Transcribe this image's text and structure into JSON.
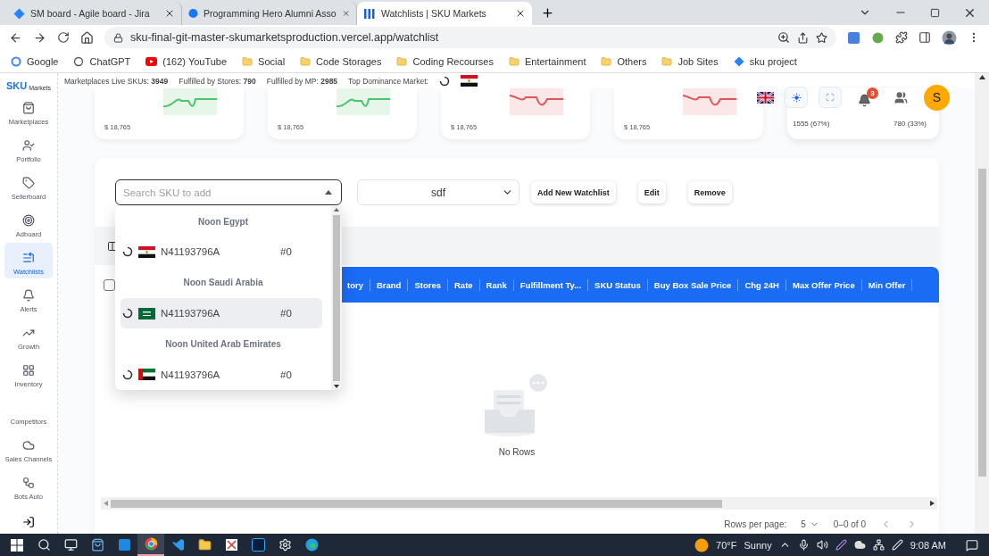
{
  "browser": {
    "tabs": [
      {
        "title": "SM board - Agile board - Jira",
        "selected": false
      },
      {
        "title": "Programming Hero Alumni Asso",
        "selected": false
      },
      {
        "title": "Watchlists | SKU Markets",
        "selected": true
      }
    ],
    "url": "sku-final-git-master-skumarketsproduction.vercel.app/watchlist",
    "bookmarks": [
      "Google",
      "ChatGPT",
      "(162) YouTube",
      "Social",
      "Code Storages",
      "Coding Recourses",
      "Entertainment",
      "Others",
      "Job Sites",
      "sku project"
    ]
  },
  "logo": {
    "brand": "SKU",
    "suffix": "Markets"
  },
  "sidebar": {
    "items": [
      {
        "label": "Marketplaces",
        "selected": false
      },
      {
        "label": "Portfolio",
        "selected": false
      },
      {
        "label": "Sellerboard",
        "selected": false
      },
      {
        "label": "Adboard",
        "selected": false
      },
      {
        "label": "Watchlists",
        "selected": true
      },
      {
        "label": "Alerts",
        "selected": false
      },
      {
        "label": "Growth",
        "selected": false
      },
      {
        "label": "Inventory",
        "selected": false
      },
      {
        "label": "Competitors",
        "selected": false
      },
      {
        "label": "Sales Channels",
        "selected": false
      },
      {
        "label": "Bots Auto",
        "selected": false
      }
    ]
  },
  "stats": [
    "Marketplaces Live SKUs: **3949**",
    "Fulfilled by Stores: **790**",
    "Fulfilled by MP: **2985**"
  ],
  "top_market": "Top Dominance Market:",
  "header": {
    "notifications": "3",
    "avatar": "S"
  },
  "cards": [
    {
      "value": "$ 18,765",
      "color": "#4cc46a"
    },
    {
      "value": "$ 18,765",
      "color": "#4cc46a"
    },
    {
      "value": "$ 18,765",
      "color": "#e05555"
    },
    {
      "value": "$ 18,765",
      "color": "#e05555"
    }
  ],
  "split_card": {
    "left": "1555 (67%)",
    "right": "780 (33%)"
  },
  "watchlist": {
    "search_placeholder": "Search SKU to add",
    "selected_list": "sdf",
    "buttons": [
      "Add New Watchlist",
      "Edit",
      "Remove"
    ]
  },
  "dropdown": {
    "groups": [
      {
        "name": "Noon Egypt",
        "items": [
          {
            "sku": "N41193796A",
            "rank": "#0",
            "selected": false
          }
        ]
      },
      {
        "name": "Noon Saudi Arabia",
        "items": [
          {
            "sku": "N41193796A",
            "rank": "#0",
            "selected": true
          }
        ]
      },
      {
        "name": "Noon United Arab Emirates",
        "items": [
          {
            "sku": "N41193796A",
            "rank": "#0",
            "selected": false
          }
        ]
      }
    ]
  },
  "table": {
    "select_all_checked": false,
    "columns": [
      "tory",
      "Brand",
      "Stores",
      "Rate",
      "Rank",
      "Fulfillment Ty...",
      "SKU Status",
      "Buy Box Sale Price",
      "Chg 24H",
      "Max Offer Price",
      "Min Offer"
    ],
    "empty_text": "No Rows",
    "pagination": {
      "label": "Rows per page:",
      "rows_per_page": "5",
      "range": "0–0 of 0"
    }
  },
  "taskbar": {
    "temperature": "70°F",
    "weather": "Sunny",
    "time": "9:08 AM"
  }
}
